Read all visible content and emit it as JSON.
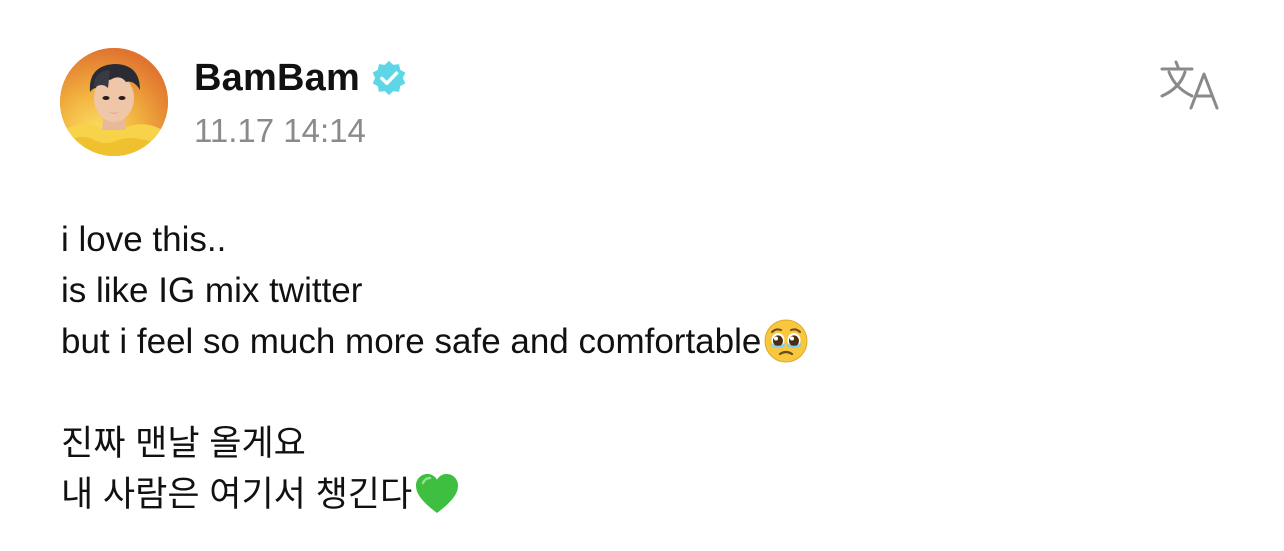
{
  "author": {
    "name": "BamBam",
    "verified": true,
    "avatar_icon": "user-avatar-photo",
    "badge_color": "#5ed6e6"
  },
  "post": {
    "timestamp": "11.17 14:14",
    "lines": [
      "i love this..",
      "is like IG mix twitter",
      "but i feel so much more safe and comfortable",
      "",
      "진짜 맨날 올게요",
      "내 사람은 여기서 챙긴다"
    ],
    "emojis": {
      "line3": "pleading-face-emoji",
      "line6": "green-heart-emoji"
    }
  },
  "actions": {
    "translate_icon": "translate-icon"
  },
  "colors": {
    "text": "#111111",
    "muted": "#8a8a8a",
    "background": "#ffffff",
    "translate_icon": "#8a8a8a",
    "green_heart": "#3fbf3f"
  }
}
